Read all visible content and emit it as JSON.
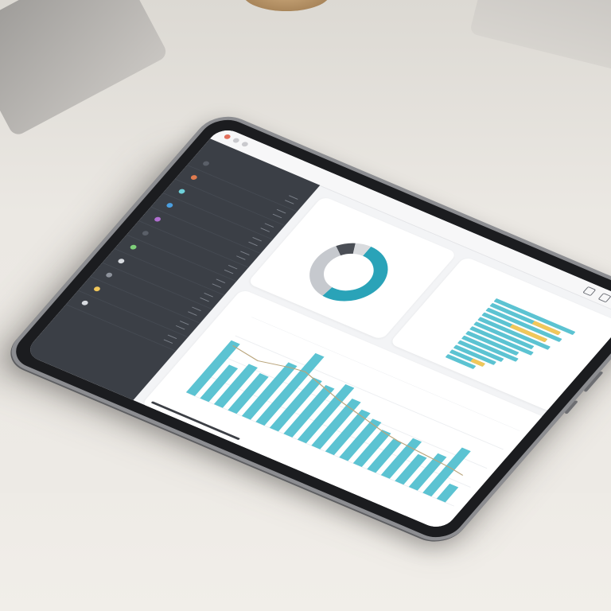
{
  "colors": {
    "accent": "#2aa3b8",
    "accent_light": "#5cc3d2",
    "yellow": "#f1c75a",
    "sidebar_bg": "#3b3f46",
    "donut_gray": "#c6c9ce",
    "donut_dark": "#4a4e55"
  },
  "donut_chart": {
    "type": "pie",
    "segments": [
      {
        "value": 52,
        "color": "#2aa3b8"
      },
      {
        "value": 33,
        "color": "#c6c9ce"
      },
      {
        "value": 8,
        "color": "#4a4e55"
      },
      {
        "value": 7,
        "color": "#d9dbde"
      }
    ]
  },
  "hbar_chart": {
    "type": "bar",
    "values": [
      90,
      78,
      84,
      72,
      80,
      66,
      70,
      58,
      62,
      50,
      46,
      38,
      32
    ],
    "highlight": [
      0,
      30,
      0,
      40,
      0,
      0,
      0,
      0,
      0,
      0,
      0,
      14,
      0
    ]
  },
  "column_chart": {
    "type": "bar",
    "values": [
      62,
      40,
      48,
      44,
      64,
      82,
      60,
      58,
      66,
      56,
      50,
      46,
      40,
      36,
      44,
      32,
      40,
      54,
      18
    ],
    "trend": [
      58,
      56,
      54,
      57,
      60,
      62,
      58,
      54,
      50,
      47,
      44,
      41,
      38,
      36,
      35,
      34,
      33,
      32,
      30
    ]
  },
  "sidebar": {
    "dot_colors": [
      "#5a5f68",
      "#e07b4f",
      "#6fd0d9",
      "#4b9fe0",
      "#b06fd0",
      "#5a5f68",
      "#7fcf7a",
      "#d8dbe0",
      "#8d929b",
      "#f1c75a",
      "#d8dbe0"
    ],
    "icons": [
      "menu-icon",
      "bell-icon"
    ]
  }
}
